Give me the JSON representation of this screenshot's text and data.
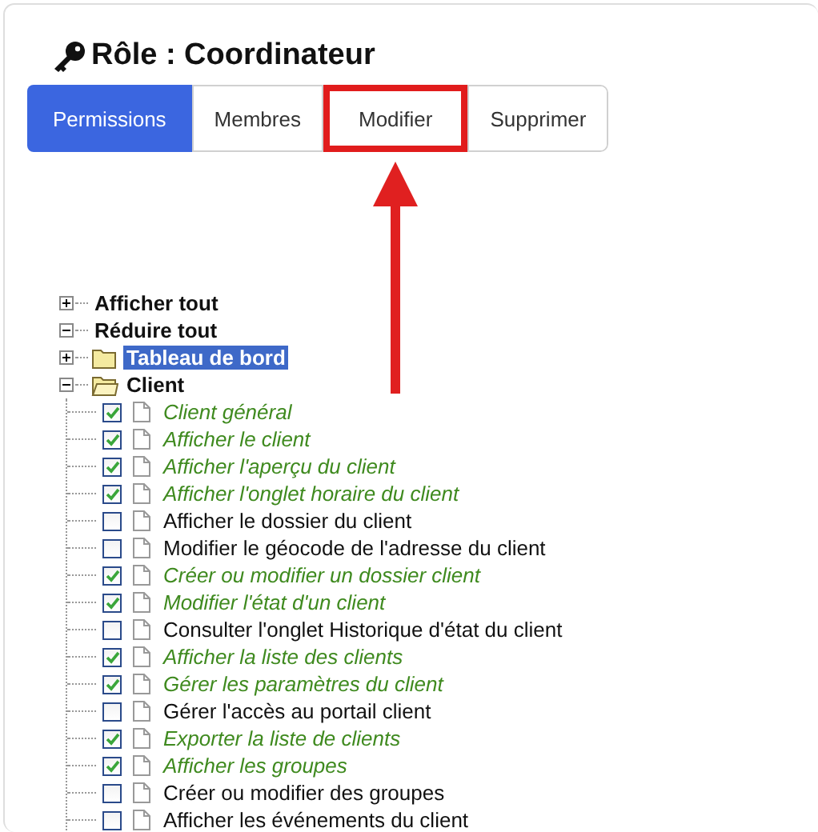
{
  "title": "Rôle : Coordinateur",
  "tabs": [
    {
      "label": "Permissions",
      "selected": true,
      "highlighted": false
    },
    {
      "label": "Membres",
      "selected": false,
      "highlighted": false
    },
    {
      "label": "Modifier",
      "selected": false,
      "highlighted": true
    },
    {
      "label": "Supprimer",
      "selected": false,
      "highlighted": false
    }
  ],
  "tree": [
    {
      "kind": "command",
      "label": "Afficher tout",
      "expanded": false
    },
    {
      "kind": "command",
      "label": "Réduire tout",
      "expanded": true
    },
    {
      "kind": "folder",
      "label": "Tableau de bord",
      "expanded": false,
      "selected": true
    },
    {
      "kind": "folder",
      "label": "Client",
      "expanded": true,
      "selected": false,
      "children": [
        {
          "label": "Client général",
          "checked": true
        },
        {
          "label": "Afficher le client",
          "checked": true
        },
        {
          "label": "Afficher l'aperçu du client",
          "checked": true
        },
        {
          "label": "Afficher l'onglet horaire du client",
          "checked": true
        },
        {
          "label": "Afficher le dossier du client",
          "checked": false
        },
        {
          "label": "Modifier le géocode de l'adresse du client",
          "checked": false
        },
        {
          "label": "Créer ou modifier un dossier client",
          "checked": true
        },
        {
          "label": "Modifier l'état d'un client",
          "checked": true
        },
        {
          "label": "Consulter l'onglet Historique d'état du client",
          "checked": false
        },
        {
          "label": "Afficher la liste des clients",
          "checked": true
        },
        {
          "label": "Gérer les paramètres du client",
          "checked": true
        },
        {
          "label": "Gérer l'accès au portail client",
          "checked": false
        },
        {
          "label": "Exporter la liste de clients",
          "checked": true
        },
        {
          "label": "Afficher les groupes",
          "checked": true
        },
        {
          "label": "Créer ou modifier des groupes",
          "checked": false
        },
        {
          "label": "Afficher les événements du client",
          "checked": false
        }
      ]
    }
  ]
}
